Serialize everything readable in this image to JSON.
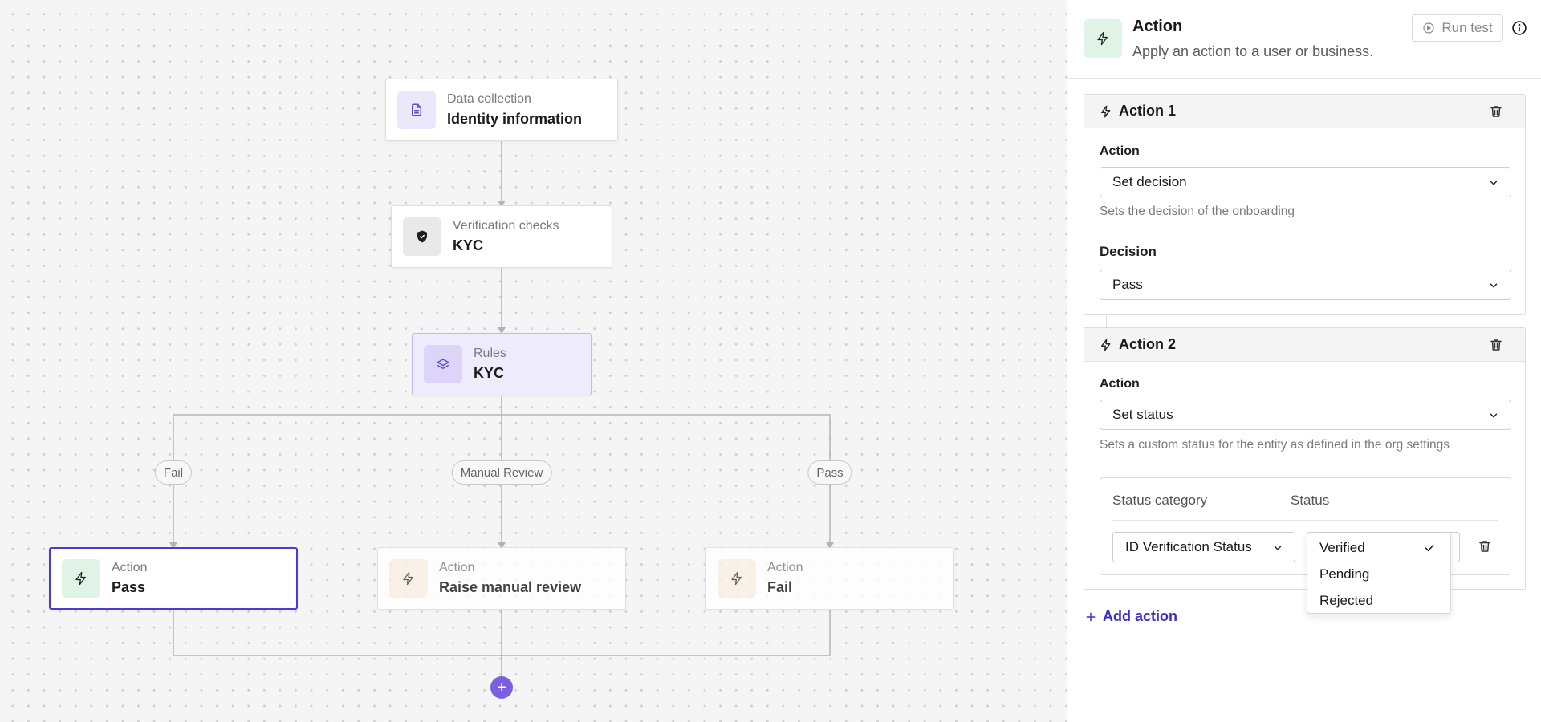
{
  "canvas": {
    "nodes": {
      "data_collection": {
        "subtitle": "Data collection",
        "title": "Identity information",
        "icon": "document-icon"
      },
      "verification": {
        "subtitle": "Verification checks",
        "title": "KYC",
        "icon": "shield-icon"
      },
      "rules": {
        "subtitle": "Rules",
        "title": "KYC",
        "icon": "layers-icon"
      },
      "action_pass": {
        "subtitle": "Action",
        "title": "Pass",
        "icon": "bolt-icon"
      },
      "action_review": {
        "subtitle": "Action",
        "title": "Raise manual review",
        "icon": "bolt-icon"
      },
      "action_fail": {
        "subtitle": "Action",
        "title": "Fail",
        "icon": "bolt-icon"
      }
    },
    "edge_labels": {
      "fail": "Fail",
      "review": "Manual Review",
      "pass": "Pass"
    },
    "add_node_label": "+"
  },
  "panel": {
    "header": {
      "title": "Action",
      "subtitle": "Apply an action to a user or business.",
      "run_test": "Run test"
    },
    "action1": {
      "title": "Action 1",
      "action_label": "Action",
      "action_value": "Set decision",
      "action_help": "Sets the decision of the onboarding",
      "decision_label": "Decision",
      "decision_value": "Pass"
    },
    "action2": {
      "title": "Action 2",
      "action_label": "Action",
      "action_value": "Set status",
      "action_help": "Sets a custom status for the entity as defined in the org settings",
      "status_category_header": "Status category",
      "status_header": "Status",
      "status_category_value": "ID Verification Status"
    },
    "status_dropdown": {
      "options": [
        "Verified",
        "Pending",
        "Rejected"
      ],
      "selected": "Verified"
    },
    "add_action": "Add action"
  },
  "colors": {
    "accent": "#4a3bd6",
    "add_button": "#7a5fe0",
    "rules_bg": "#eeebfc",
    "green_icon_bg": "#dff3e7",
    "orange_icon_bg": "#fbefe4"
  }
}
